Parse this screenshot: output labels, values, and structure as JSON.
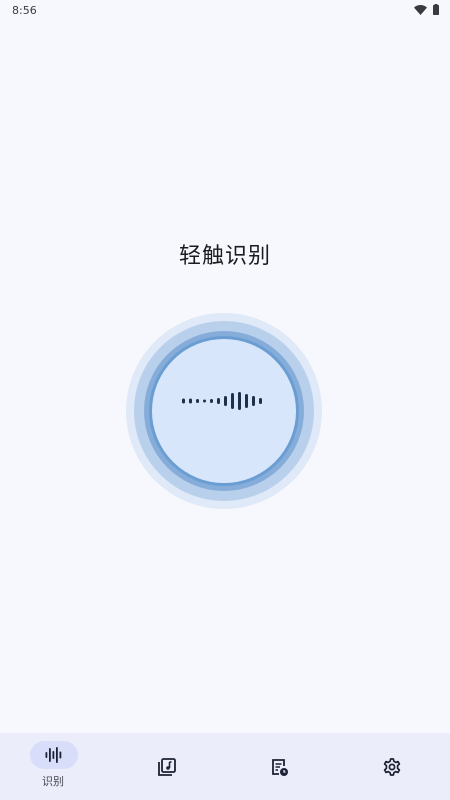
{
  "status_bar": {
    "time": "8:56",
    "icons": [
      "wifi-icon",
      "battery-icon"
    ]
  },
  "main": {
    "title": "轻触识别",
    "recognize_button_icon": "sound-wave-icon"
  },
  "bottom_nav": {
    "items": [
      {
        "label": "识别",
        "icon": "sound-wave-icon",
        "selected": true
      },
      {
        "label": "",
        "icon": "music-library-icon",
        "selected": false
      },
      {
        "label": "",
        "icon": "history-list-icon",
        "selected": false
      },
      {
        "label": "",
        "icon": "gear-icon",
        "selected": false
      }
    ]
  },
  "colors": {
    "background": "#f7f8fd",
    "accent": "#6a9ed3",
    "nav_background": "#ebeefa",
    "nav_selected_pill": "#d8defa"
  }
}
